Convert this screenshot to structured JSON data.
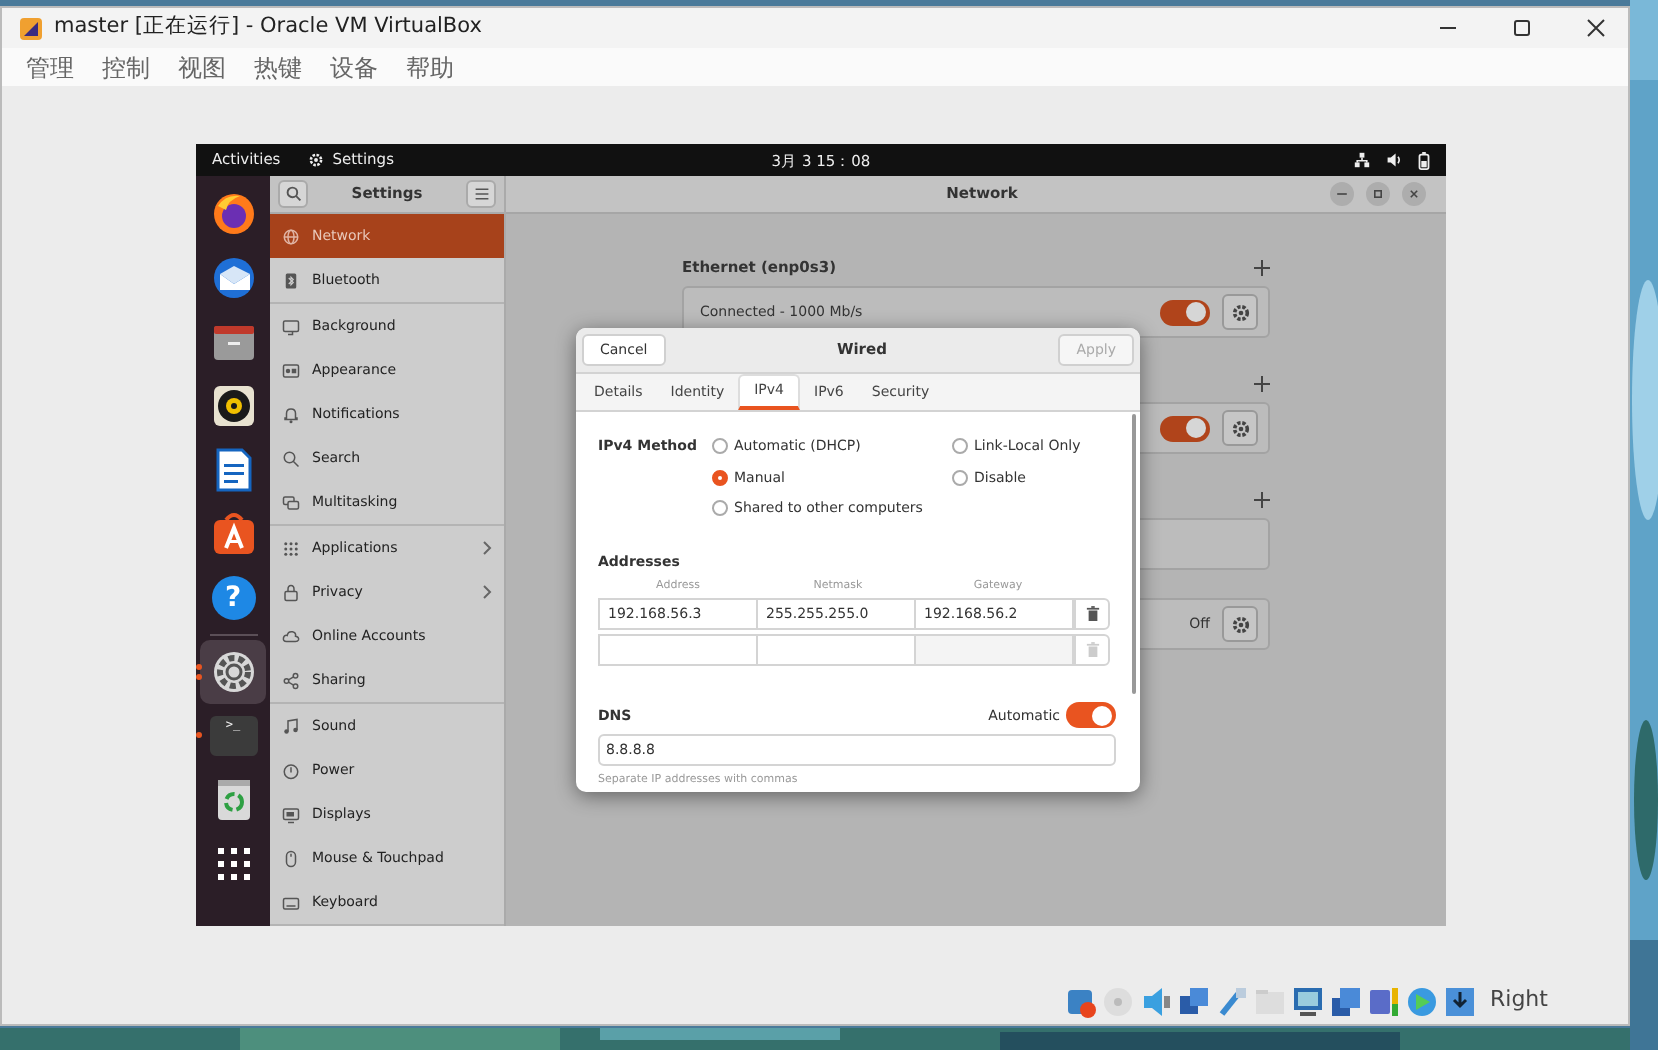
{
  "host_window": {
    "title": "master [正在运行] - Oracle VM VirtualBox",
    "menu": [
      "管理",
      "控制",
      "视图",
      "热键",
      "设备",
      "帮助"
    ]
  },
  "top_bar": {
    "activities": "Activities",
    "app": "Settings",
    "clock": "3月 3 15：08"
  },
  "dock": [
    {
      "kind": "firefox",
      "selected": false,
      "running": false
    },
    {
      "kind": "mail",
      "selected": false,
      "running": false
    },
    {
      "kind": "files",
      "selected": false,
      "running": false
    },
    {
      "kind": "music",
      "selected": false,
      "running": false
    },
    {
      "kind": "writer",
      "selected": false,
      "running": false
    },
    {
      "kind": "store",
      "selected": false,
      "running": false
    },
    {
      "kind": "help",
      "glyph": "?",
      "selected": false,
      "running": false
    },
    {
      "kind": "separator"
    },
    {
      "kind": "settings",
      "selected": true,
      "running": true
    },
    {
      "kind": "terminal",
      "glyph": ">_",
      "selected": false,
      "running": true
    },
    {
      "kind": "trash",
      "selected": false,
      "running": false
    },
    {
      "kind": "apps",
      "selected": false,
      "running": false
    }
  ],
  "sidebar": {
    "title": "Settings",
    "groups": [
      {
        "items": [
          {
            "label": "Network",
            "kind": "network",
            "selected": true
          },
          {
            "label": "Bluetooth",
            "kind": "bluetooth",
            "selected": false
          }
        ]
      },
      {
        "items": [
          {
            "label": "Background",
            "kind": "background",
            "selected": false
          },
          {
            "label": "Appearance",
            "kind": "appearance",
            "selected": false
          },
          {
            "label": "Notifications",
            "kind": "bell",
            "selected": false
          },
          {
            "label": "Search",
            "kind": "search",
            "selected": false
          },
          {
            "label": "Multitasking",
            "kind": "windows",
            "selected": false
          }
        ]
      },
      {
        "items": [
          {
            "label": "Applications",
            "kind": "grid",
            "selected": false,
            "submenu": true
          },
          {
            "label": "Privacy",
            "kind": "lock",
            "selected": false,
            "submenu": true
          },
          {
            "label": "Online Accounts",
            "kind": "cloud",
            "selected": false
          },
          {
            "label": "Sharing",
            "kind": "share",
            "selected": false
          }
        ]
      },
      {
        "items": [
          {
            "label": "Sound",
            "kind": "note",
            "selected": false
          },
          {
            "label": "Power",
            "kind": "power",
            "selected": false
          },
          {
            "label": "Displays",
            "kind": "display",
            "selected": false
          },
          {
            "label": "Mouse & Touchpad",
            "kind": "mouse",
            "selected": false
          },
          {
            "label": "Keyboard",
            "kind": "keyboard",
            "selected": false
          }
        ]
      }
    ]
  },
  "network_panel": {
    "title": "Network",
    "sections": [
      {
        "title": "Ethernet (enp0s3)",
        "add": true,
        "row": {
          "kind": "switch",
          "status": "Connected - 1000 Mb/s",
          "on": true
        }
      },
      {
        "add": true,
        "row": {
          "kind": "switch",
          "on": true
        }
      },
      {
        "add": true,
        "row": {
          "kind": "empty"
        }
      },
      {
        "add": false,
        "row": {
          "kind": "state",
          "status": "Off"
        }
      }
    ]
  },
  "dialog": {
    "title": "Wired",
    "cancel": "Cancel",
    "apply": {
      "label": "Apply",
      "disabled": true
    },
    "tabs": [
      {
        "label": "Details",
        "selected": false
      },
      {
        "label": "Identity",
        "selected": false
      },
      {
        "label": "IPv4",
        "selected": true
      },
      {
        "label": "IPv6",
        "selected": false
      },
      {
        "label": "Security",
        "selected": false
      }
    ],
    "method": {
      "label": "IPv4 Method",
      "options": [
        {
          "label": "Automatic (DHCP)",
          "selected": false
        },
        {
          "label": "Link-Local Only",
          "selected": false
        },
        {
          "label": "Manual",
          "selected": true
        },
        {
          "label": "Disable",
          "selected": false
        },
        {
          "label": "Shared to other computers",
          "selected": false
        }
      ]
    },
    "addresses": {
      "label": "Addresses",
      "columns": [
        "Address",
        "Netmask",
        "Gateway"
      ],
      "rows": [
        {
          "cells": [
            "192.168.56.3",
            "255.255.255.0",
            "192.168.56.2"
          ],
          "disabled": false
        },
        {
          "disabled": true
        }
      ]
    },
    "dns": {
      "label": "DNS",
      "automatic_label": "Automatic",
      "automatic": true,
      "value": "8.8.8.8",
      "hint": "Separate IP addresses with commas"
    }
  },
  "status_bar": {
    "host_key": "Right"
  }
}
